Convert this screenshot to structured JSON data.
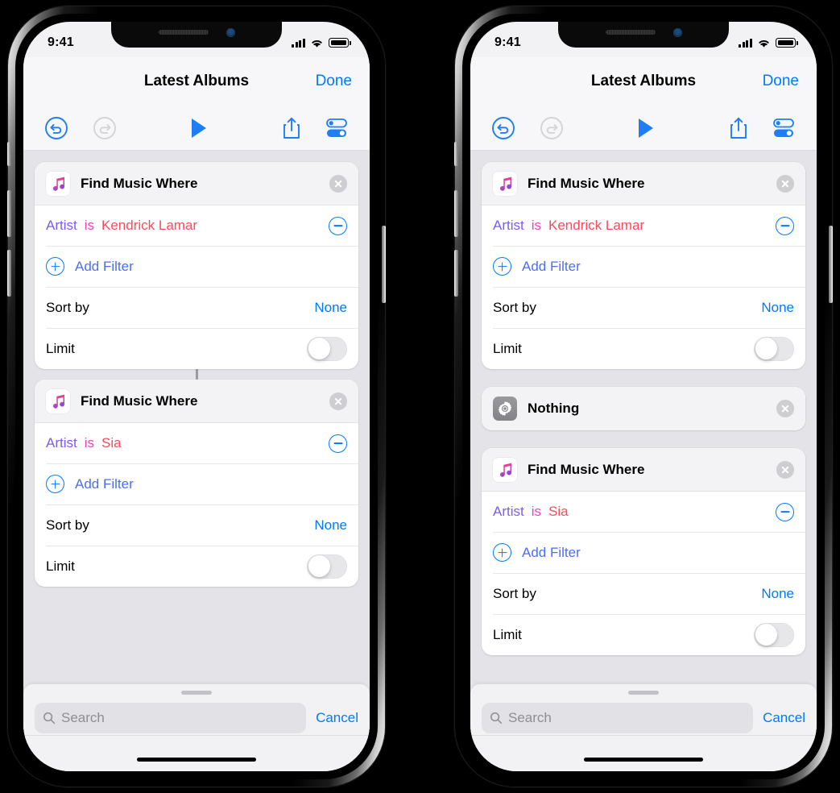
{
  "status_bar": {
    "time": "9:41",
    "signal_icon": "cellular-bars-icon",
    "wifi_icon": "wifi-icon",
    "battery_icon": "battery-full-icon"
  },
  "nav": {
    "title": "Latest Albums",
    "done_label": "Done"
  },
  "toolbar": {
    "undo": "undo-icon",
    "redo": "redo-icon",
    "play": "play-icon",
    "share": "share-icon",
    "settings": "settings-sliders-icon"
  },
  "card_defaults": {
    "app_icon": "apple-music-icon",
    "title": "Find Music Where",
    "close": "close-circle-icon",
    "filter_field": "Artist",
    "filter_operator": "is",
    "remove_icon": "minus-circle-icon",
    "add_filter_label": "Add Filter",
    "add_icon": "plus-circle-icon",
    "sort_label": "Sort by",
    "sort_value": "None",
    "limit_label": "Limit",
    "limit_toggle_state": "off"
  },
  "search": {
    "placeholder": "Search",
    "cancel_label": "Cancel",
    "icon": "search-icon"
  },
  "phones": [
    {
      "name": "left-phone",
      "cards": [
        {
          "type": "find-music",
          "title": "Find Music Where",
          "filter_field": "Artist",
          "filter_operator": "is",
          "filter_value": "Kendrick Lamar",
          "add_filter_label": "Add Filter",
          "sort_label": "Sort by",
          "sort_value": "None",
          "limit_label": "Limit"
        },
        {
          "type": "connector"
        },
        {
          "type": "find-music",
          "title": "Find Music Where",
          "filter_field": "Artist",
          "filter_operator": "is",
          "filter_value": "Sia",
          "add_filter_label": "Add Filter",
          "sort_label": "Sort by",
          "sort_value": "None",
          "limit_label": "Limit"
        }
      ]
    },
    {
      "name": "right-phone",
      "cards": [
        {
          "type": "find-music",
          "title": "Find Music Where",
          "filter_field": "Artist",
          "filter_operator": "is",
          "filter_value": "Kendrick Lamar",
          "add_filter_label": "Add Filter",
          "sort_label": "Sort by",
          "sort_value": "None",
          "limit_label": "Limit"
        },
        {
          "type": "nothing",
          "title": "Nothing",
          "icon": "gear-icon"
        },
        {
          "type": "find-music",
          "title": "Find Music Where",
          "filter_field": "Artist",
          "filter_operator": "is",
          "filter_value": "Sia",
          "add_filter_label": "Add Filter",
          "sort_label": "Sort by",
          "sort_value": "None",
          "limit_label": "Limit"
        }
      ]
    }
  ],
  "colors": {
    "accent_blue": "#007aff",
    "field_purple": "#7b5cf0",
    "operator_magenta": "#f040c0",
    "value_red": "#fb4a5a",
    "canvas_gray": "#e4e4e8",
    "chrome_gray": "#f7f7f9"
  }
}
